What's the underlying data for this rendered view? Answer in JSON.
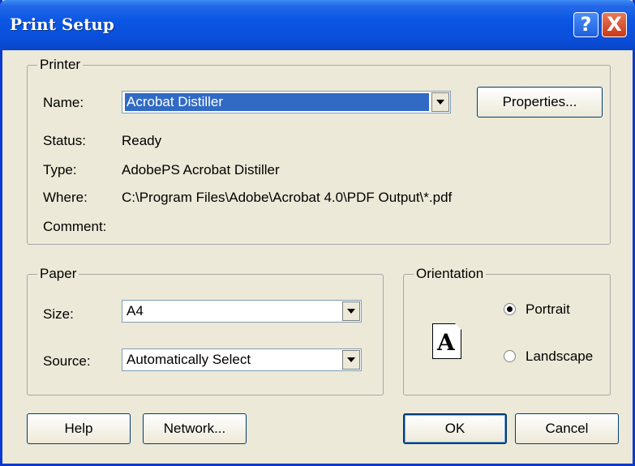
{
  "window": {
    "title": "Print Setup",
    "help_glyph": "?",
    "close_glyph": "X"
  },
  "printer": {
    "legend": "Printer",
    "name_label": "Name:",
    "name_value": "Acrobat Distiller",
    "properties_button": "Properties...",
    "status_label": "Status:",
    "status_value": "Ready",
    "type_label": "Type:",
    "type_value": "AdobePS Acrobat Distiller",
    "where_label": "Where:",
    "where_value": "C:\\Program Files\\Adobe\\Acrobat 4.0\\PDF Output\\*.pdf",
    "comment_label": "Comment:",
    "comment_value": ""
  },
  "paper": {
    "legend": "Paper",
    "size_label": "Size:",
    "size_value": "A4",
    "source_label": "Source:",
    "source_value": "Automatically Select"
  },
  "orientation": {
    "legend": "Orientation",
    "page_glyph": "A",
    "portrait_label": "Portrait",
    "landscape_label": "Landscape",
    "selected": "Portrait"
  },
  "buttons": {
    "help": "Help",
    "network": "Network...",
    "ok": "OK",
    "cancel": "Cancel"
  }
}
